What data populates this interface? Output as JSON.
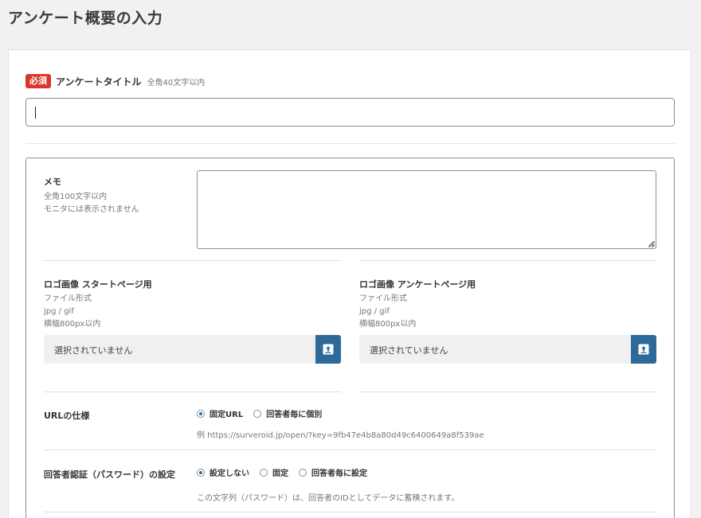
{
  "page": {
    "title": "アンケート概要の入力"
  },
  "survey_title": {
    "required_badge": "必須",
    "label": "アンケートタイトル",
    "hint": "全角40文字以内",
    "value": ""
  },
  "memo": {
    "label": "メモ",
    "hint_line1": "全角100文字以内",
    "hint_line2": "モニタには表示されません",
    "value": ""
  },
  "logo_start": {
    "label": "ロゴ画像 スタートページ用",
    "hint_line1": "ファイル形式",
    "hint_line2": "jpg / gif",
    "hint_line3": "横幅800px以内",
    "file_status": "選択されていません"
  },
  "logo_survey": {
    "label": "ロゴ画像 アンケートページ用",
    "hint_line1": "ファイル形式",
    "hint_line2": "jpg / gif",
    "hint_line3": "横幅800px以内",
    "file_status": "選択されていません"
  },
  "url_spec": {
    "label": "URLの仕様",
    "options": [
      {
        "label": "固定URL",
        "checked": true
      },
      {
        "label": "回答者毎に個別",
        "checked": false
      }
    ],
    "example": "例 https://surveroid.jp/open/?key=9fb47e4b8a80d49c6400649a8f539ae"
  },
  "auth": {
    "label": "回答者認証（パスワード）の設定",
    "options": [
      {
        "label": "設定しない",
        "checked": true
      },
      {
        "label": "固定",
        "checked": false
      },
      {
        "label": "回答者毎に設定",
        "checked": false
      }
    ],
    "note": "この文字列（パスワード）は、回答者のIDとしてデータに蓄積されます。"
  },
  "colors": {
    "accent": "#2e6a99",
    "required": "#d9362b"
  },
  "icons": {
    "upload": "upload-icon",
    "resize": "resize-grip-icon"
  }
}
